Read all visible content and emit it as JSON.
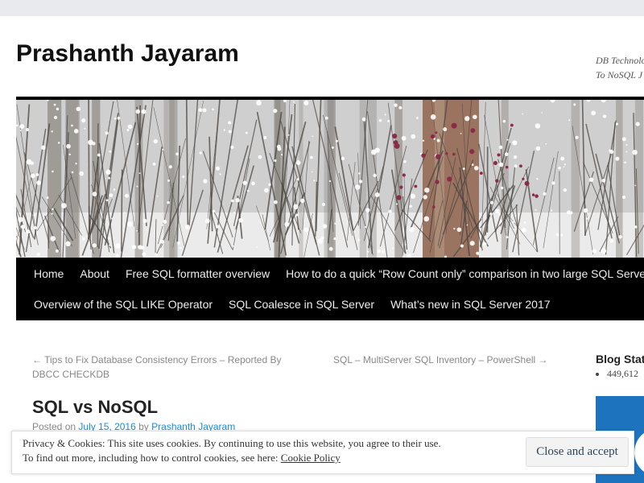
{
  "site": {
    "title": "Prashanth Jayaram",
    "description_line1": "DB Technolo",
    "description_line2": "To NoSQL J"
  },
  "nav": {
    "items": [
      "Home",
      "About",
      "Free SQL formatter overview",
      "How to do a quick “Row Count only” comparison in two large SQL Server databases",
      "Overview of the SQL LIKE Operator",
      "SQL Coalesce in SQL Server",
      "What’s new in SQL Server 2017"
    ]
  },
  "post_nav": {
    "prev_line1": "← Tips to Fix Database Consistency Errors – Reported By",
    "prev_line2": "DBCC CHECKDB",
    "next": "SQL – MultiServer SQL Inventory – PowerShell →"
  },
  "entry": {
    "title": "SQL vs NoSQL",
    "posted_on": "Posted on",
    "date": "July 15, 2016",
    "by": "by",
    "author": "Prashanth Jayaram"
  },
  "sidebar": {
    "title": "Blog Stats",
    "stat": "449,612"
  },
  "cookie": {
    "line1": "Privacy & Cookies: This site uses cookies. By continuing to use this website, you agree to their use.",
    "line2_prefix": "To find out more, including how to control cookies, see here:",
    "policy_link": "Cookie Policy",
    "close_button": "Close and accept"
  },
  "colors": {
    "nav_bg": "#000000",
    "link_blue": "#1b8be0",
    "widget_blue": "#1e73be"
  }
}
